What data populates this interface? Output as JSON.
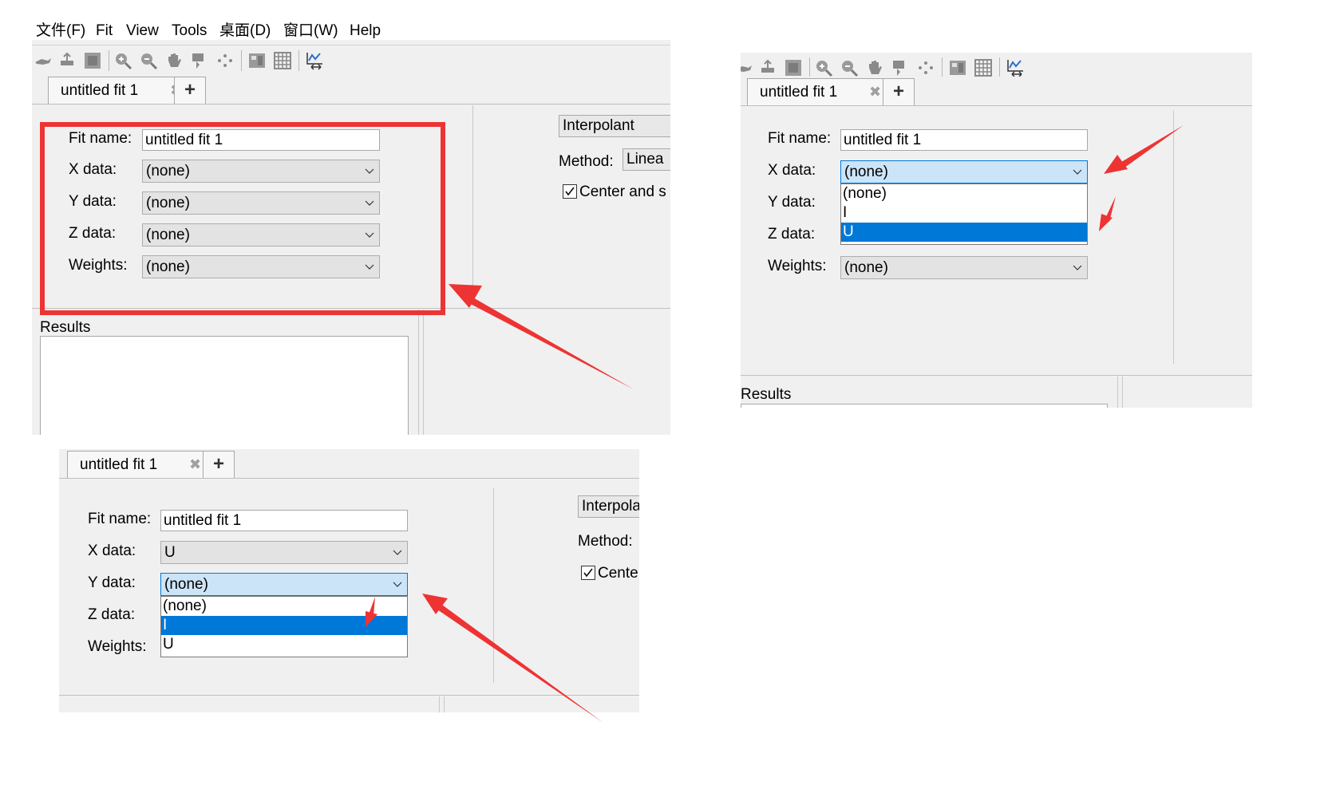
{
  "menu": [
    "文件(F)",
    "Fit",
    "View",
    "Tools",
    "桌面(D)",
    "窗口(W)",
    "Help"
  ],
  "toolbar_icons": [
    "rotate-icon",
    "pan-3d-icon",
    "data-cursor-icon",
    "zoom-in-icon",
    "zoom-out-icon",
    "pan-hand-icon",
    "data-tips-icon",
    "exclude-outliers-icon",
    "legend-icon",
    "grid-icon",
    "axes-limits-icon"
  ],
  "tab": {
    "label": "untitled fit 1",
    "close_glyph": "✖",
    "add_glyph": "+"
  },
  "form_labels": {
    "fit_name": "Fit name:",
    "x_data": "X data:",
    "y_data": "Y data:",
    "z_data": "Z data:",
    "weights": "Weights:"
  },
  "results_label": "Results",
  "panel1": {
    "fit_name_value": "untitled fit 1",
    "x_value": "(none)",
    "y_value": "(none)",
    "z_value": "(none)",
    "weights_value": "(none)",
    "fit_type": "Interpolant",
    "method_label": "Method:",
    "method_value": "Linea",
    "center_label": "Center and s"
  },
  "panel2": {
    "fit_name_value": "untitled fit 1",
    "x_value": "(none)",
    "weights_value": "(none)",
    "dropdown_options": [
      "(none)",
      "I",
      "U"
    ],
    "selected_index": 2
  },
  "panel3": {
    "fit_name_value": "untitled fit 1",
    "x_value": "U",
    "y_value": "(none)",
    "dropdown_options": [
      "(none)",
      "I",
      "U"
    ],
    "selected_index": 1,
    "fit_type": "Interpola",
    "method_label": "Method:",
    "center_label": "Cente"
  },
  "colors": {
    "annotation_red": "#ee3333",
    "selection_blue": "#0078d7",
    "active_combo": "#cce4f7",
    "panel_bg": "#f0f0f0"
  }
}
